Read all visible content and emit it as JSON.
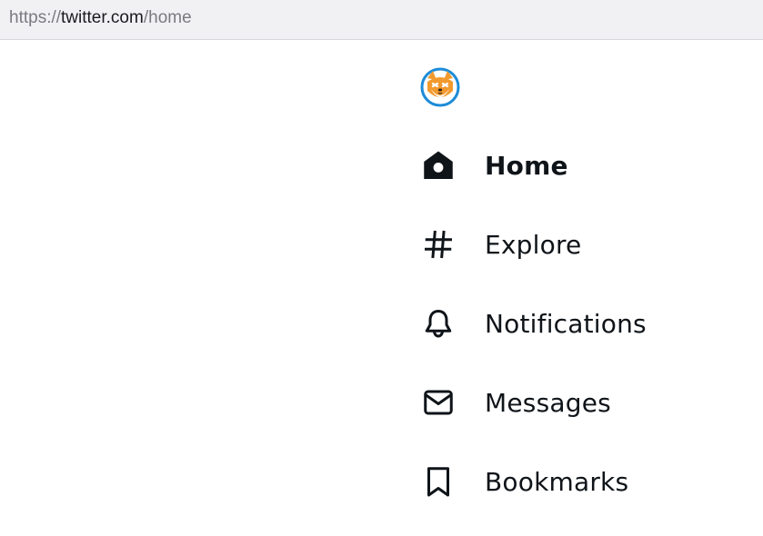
{
  "browser": {
    "url_scheme": "https://",
    "url_host": "twitter.com",
    "url_path": "/home"
  },
  "sidebar": {
    "logo_icon": "shiba-avatar-logo",
    "items": [
      {
        "label": "Home",
        "icon": "home-icon",
        "active": true
      },
      {
        "label": "Explore",
        "icon": "hashtag-icon",
        "active": false
      },
      {
        "label": "Notifications",
        "icon": "bell-icon",
        "active": false
      },
      {
        "label": "Messages",
        "icon": "envelope-icon",
        "active": false
      },
      {
        "label": "Bookmarks",
        "icon": "bookmark-icon",
        "active": false
      }
    ]
  },
  "colors": {
    "text": "#0f1419",
    "address_bar_bg": "#f1f1f4",
    "logo_ring": "#1d8bd8",
    "logo_fur": "#f29a2e"
  }
}
